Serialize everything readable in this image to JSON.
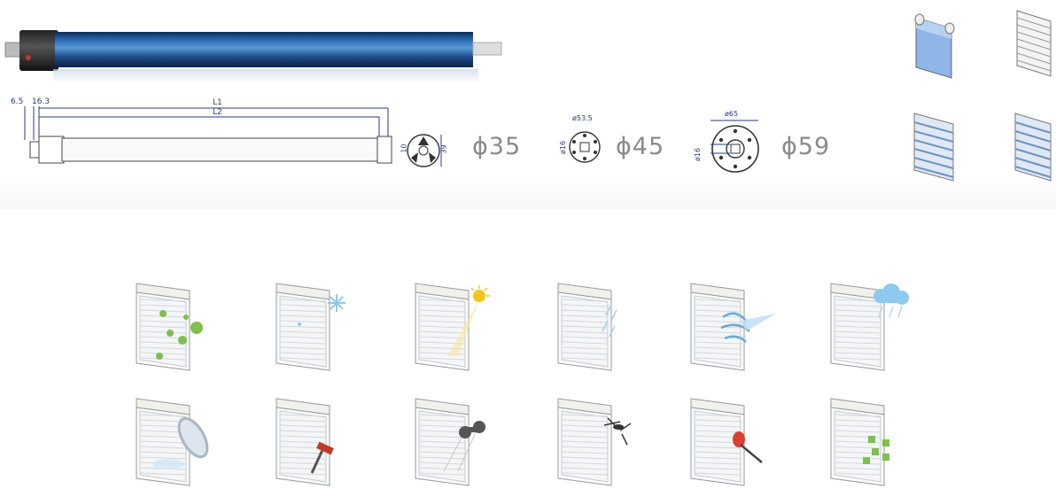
{
  "dimensions": {
    "d1": "6.5",
    "d2": "16.3",
    "l1": "L1",
    "l2": "L2",
    "end_10": "10",
    "end_39": "39",
    "pcd_45": "ø53.5",
    "hub_45": "ø16",
    "outer_59": "ø65",
    "hub_59": "ø16"
  },
  "diameters": [
    {
      "label": "ϕ35"
    },
    {
      "label": "ϕ45"
    },
    {
      "label": "ϕ59"
    }
  ],
  "colors": {
    "tube": "#1d4d8a",
    "dimension_line": "#2a3a7a",
    "diameter_text": "#8a8a8a"
  },
  "application_icons": [
    {
      "icon": "eco-recycle-icon"
    },
    {
      "icon": "cold-snow-icon"
    },
    {
      "icon": "sun-heat-icon"
    },
    {
      "icon": "rain-icon"
    },
    {
      "icon": "wind-icon"
    },
    {
      "icon": "cloud-storm-icon"
    },
    {
      "icon": "privacy-eye-icon"
    },
    {
      "icon": "burglary-hammer-icon"
    },
    {
      "icon": "binoculars-icon"
    },
    {
      "icon": "insect-mosquito-icon"
    },
    {
      "icon": "security-crowbar-icon"
    },
    {
      "icon": "light-control-icon"
    }
  ],
  "blind_types": [
    {
      "icon": "roller-blind-icon"
    },
    {
      "icon": "venetian-blind-icon"
    },
    {
      "icon": "horizontal-blind-icon"
    },
    {
      "icon": "pleated-blind-icon"
    }
  ]
}
